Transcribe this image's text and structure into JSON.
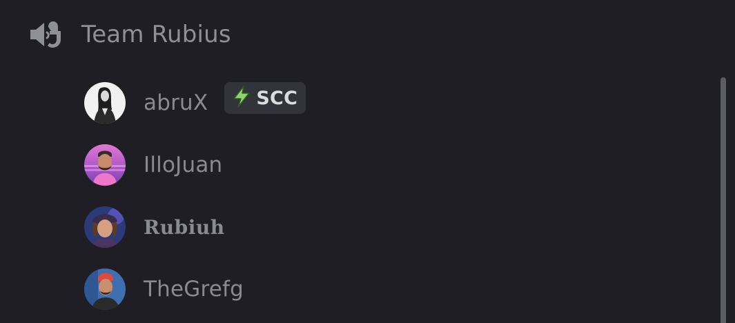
{
  "channel": {
    "name": "Team Rubius",
    "icon": "voice-channel-icon"
  },
  "users": [
    {
      "name": "abruX",
      "avatar": "avatar-icon",
      "tag": {
        "icon": "lightning-bolt-icon",
        "label": "SCC"
      }
    },
    {
      "name": "IlloJuan",
      "avatar": "avatar-icon"
    },
    {
      "name": "Rubiuh",
      "avatar": "avatar-icon"
    },
    {
      "name": "TheGrefg",
      "avatar": "avatar-icon"
    }
  ],
  "colors": {
    "background": "#1f1e24",
    "text_muted": "#8a8b92",
    "tag_background": "#33333b",
    "tag_text": "#dbdce0",
    "bolt_green": "#6fbf4a"
  }
}
